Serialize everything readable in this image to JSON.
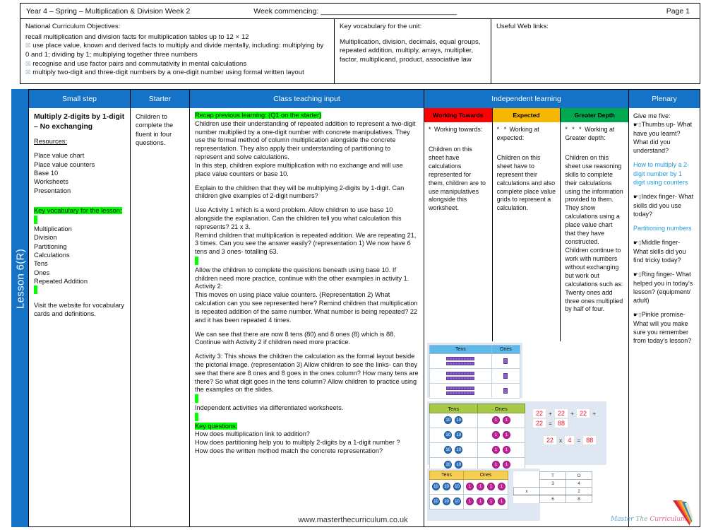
{
  "header": {
    "title": "Year 4 – Spring – Multiplication & Division Week 2",
    "week_commencing": "Week commencing: _________________________________",
    "page": "Page 1"
  },
  "objectives": {
    "nc_heading": "National Curriculum Objectives:",
    "nc_line1": "recall multiplication and division facts for multiplication tables up to 12 × 12",
    "nc_items": [
      "use place value, known and derived facts to multiply and divide mentally, including: multiplying by 0 and 1; dividing by 1; multiplying together three numbers",
      "recognise and use factor pairs and commutativity in mental calculations",
      "multiply two-digit and three-digit numbers by a one-digit number using formal written layout"
    ],
    "vocab_heading": "Key vocabulary for the unit:",
    "vocab_body": "Multiplication, division, decimals, equal groups, repeated addition, multiply, arrays, multiplier, factor, multiplicand, product, associative law",
    "web_heading": "Useful Web links:"
  },
  "columns": {
    "small_step": "Small step",
    "starter": "Starter",
    "class_teaching": "Class teaching input",
    "independent": "Independent learning",
    "plenary": "Plenary"
  },
  "spine": {
    "lesson_label": "Lesson 6(R)"
  },
  "small_step": {
    "title": "Multiply 2-digits by 1-digit – No exchanging",
    "resources_heading": "Resources:",
    "resources": [
      "Place value chart",
      "Place value counters",
      "Base 10",
      "Worksheets",
      "Presentation"
    ],
    "vocab_heading": "Key vocabulary for the lesson:",
    "vocab": [
      "Multiplication",
      "Division",
      "Partitioning",
      "Calculations",
      "Tens",
      "Ones",
      "Repeated Addition"
    ],
    "footer_note": "Visit the website for vocabulary cards and definitions."
  },
  "starter": {
    "text": "Children to complete the fluent in four questions."
  },
  "teaching": {
    "recap_heading": "Recap previous learning: (Q1 on the starter)",
    "paragraphs": [
      "Children use their understanding of repeated addition to represent a two-digit number multiplied by a one-digit number with concrete manipulatives. They use the formal method of column multiplication alongside the concrete representation. They also apply their understanding of partitioning to represent and solve calculations.",
      "In this step, children explore multiplication with no exchange and will use place value counters or base 10.",
      "Explain to the children that they will be multiplying 2-digits by 1-digit. Can children give examples of 2-digit numbers?",
      "Use Activity 1 which is a word problem. Allow children to use base 10 alongside the explanation. Can the children tell you what calculation this represents? 21 x 3.",
      "Remind children that multiplication is repeated addition. We are repeating 21, 3 times. Can you see the answer easily? (representation 1) We now have 6 tens and 3 ones- totalling 63.",
      "Allow the children to complete the questions beneath using base 10. If children need more practice, continue with the other examples in activity 1.",
      "Activity 2:",
      "This moves on using place value counters.  (Representation 2) What calculation can you see represented here? Remind children that multiplication is repeated addition of the same number. What number is being repeated? 22 and it has been repeated 4 times.",
      "We can see that there are now 8 tens (80) and 8 ones (8) which is 88. Continue with Activity 2 if children need more practice.",
      "Activity 3: This shows the children the calculation as the formal layout beside the pictorial image. (representation 3) Allow children to see the links- can they see that there are 8 ones and 8 goes in the ones column? How many tens are there? So what digit goes in the tens column?  Allow children to practice using the examples on the slides.",
      "Independent activities via differentiated worksheets."
    ],
    "key_questions_heading": "Key questions:",
    "key_questions": [
      "How does multiplication link to addition?",
      "How does partitioning help you to multiply 2-digits by a 1-digit number ?",
      "How does the written method match the concrete representation?"
    ]
  },
  "differentiation": {
    "headings": [
      "Working Towards",
      "Expected",
      "Greater Depth"
    ],
    "colors": {
      "working_towards": "#FF0000",
      "expected": "#F5B700",
      "greater_depth": "#00A94F"
    },
    "working_towards": {
      "stars": "*",
      "label": "Working towards:",
      "body": "Children on this sheet have calculations represented for them, children are to use manipulatives alongside this worksheet."
    },
    "expected": {
      "stars": "* *",
      "label": "Working at expected:",
      "body": "Children on this sheet have to represent their calculations and also complete place value grids to represent a calculation."
    },
    "greater_depth": {
      "stars": "* * *",
      "label": "Working at Greater depth:",
      "body": "Children on this sheet use reasoning skills to complete their calculations using the information provided to them. They show calculations using a place value chart that they have constructed. Children continue to work with numbers without exchanging but work out calculations such as: Twenty ones add three ones multiplied by half of four."
    }
  },
  "diagrams": {
    "base10": {
      "tens_header": "Tens",
      "ones_header": "Ones",
      "rows": [
        {
          "rods": 2,
          "cubes": 1
        },
        {
          "rods": 2,
          "cubes": 1
        },
        {
          "rods": 2,
          "cubes": 1
        }
      ]
    },
    "counters": {
      "tens_header": "Tens",
      "ones_header": "Ones",
      "ten_label": "10",
      "one_label": "1",
      "rows": [
        {
          "tens": 2,
          "ones": 2
        },
        {
          "tens": 2,
          "ones": 2
        },
        {
          "tens": 2,
          "ones": 2
        },
        {
          "tens": 2,
          "ones": 2
        }
      ],
      "equation_repeated": [
        "22",
        "+",
        "22",
        "+",
        "22",
        "+",
        "22",
        "=",
        "88"
      ],
      "equation_product": [
        "22",
        "x",
        "4",
        "=",
        "88"
      ]
    },
    "formal": {
      "tens_header": "Tens",
      "ones_header": "Ones",
      "ten_label": "10",
      "one_label": "1",
      "rows": [
        {
          "tens": 3,
          "ones": 4
        },
        {
          "tens": 3,
          "ones": 4
        }
      ],
      "column_grid": {
        "headers": [
          "",
          "T",
          "O"
        ],
        "row1": [
          "",
          "3",
          "4"
        ],
        "row2": [
          "x",
          "",
          "2"
        ],
        "row3": [
          "",
          "6",
          "8"
        ]
      }
    }
  },
  "plenary": {
    "intro": "Give me five:",
    "items": [
      {
        "glyph": "thumbs-up",
        "text": "Thumbs up- What have you learnt? What did you understand?"
      },
      {
        "glyph": "index-finger",
        "text": "Index finger- What skills did you use today?"
      },
      {
        "glyph": "middle-finger",
        "text": "Middle finger- What skills did you find tricky today?"
      },
      {
        "glyph": "ring-finger",
        "text": "Ring finger- What helped you in today's lesson? (equipment/ adult)"
      },
      {
        "glyph": "pinkie",
        "text": "Pinkie promise- What will you make sure you remember from today's lesson?"
      }
    ],
    "links": [
      "How to multiply a 2-digit number by 1 digit using counters",
      "Partitioning numbers"
    ],
    "link_color": "#1F9BD8"
  },
  "footer": {
    "website": "www.masterthecurriculum.co.uk",
    "logo_words": [
      "Master",
      "The",
      "Curriculum"
    ]
  }
}
